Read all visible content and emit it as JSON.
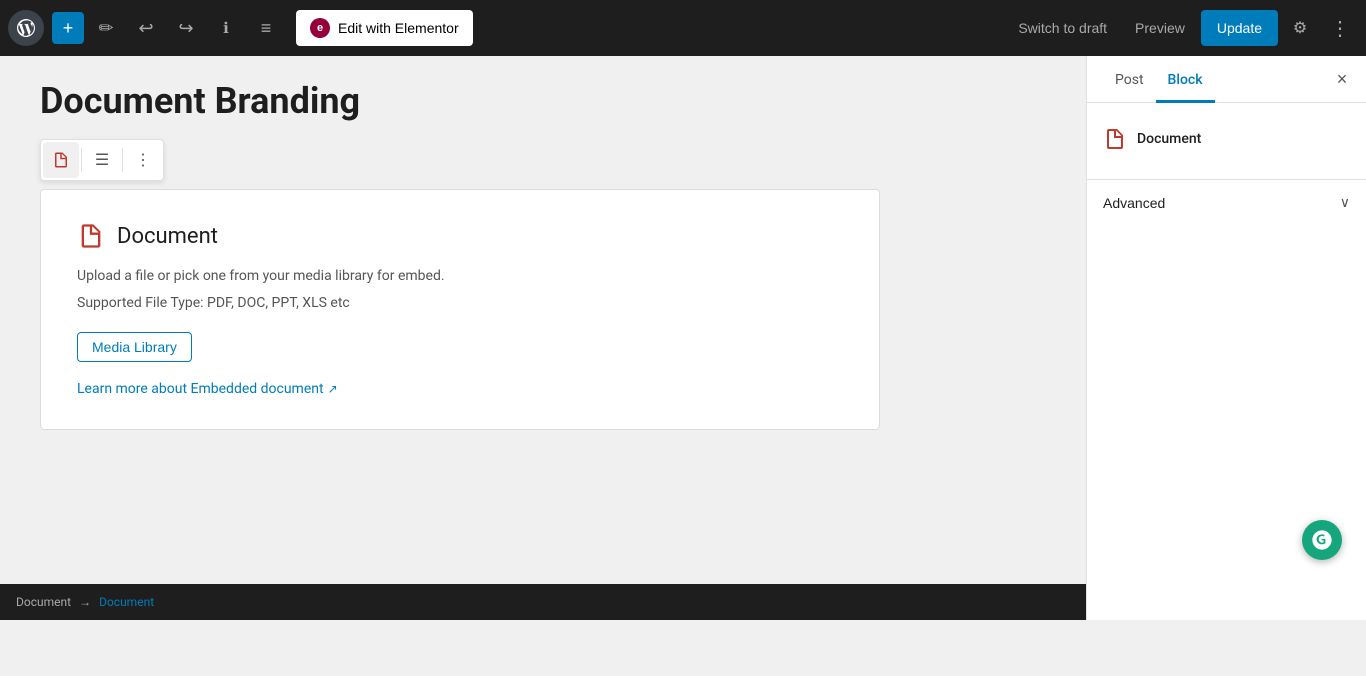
{
  "toolbar": {
    "add_label": "+",
    "edit_with_elementor": "Edit with Elementor",
    "elementor_icon": "e",
    "switch_to_draft": "Switch to draft",
    "preview": "Preview",
    "update": "Update"
  },
  "page": {
    "title": "Document Branding"
  },
  "block_toolbar": {
    "icon_btn_title": "Document icon",
    "list_btn_title": "List view",
    "more_btn_title": "More options"
  },
  "document_block": {
    "title": "Document",
    "description_line1": "Upload a file or pick one from your media library for embed.",
    "description_line2": "Supported File Type: PDF, DOC, PPT, XLS etc",
    "media_library_btn": "Media Library",
    "learn_more_text": "Learn more about Embedded document",
    "learn_more_icon": "↗"
  },
  "sidebar": {
    "post_tab": "Post",
    "block_tab": "Block",
    "close_label": "×",
    "block_panel": {
      "icon_label": "Document",
      "block_name": "Document"
    },
    "advanced_label": "Advanced",
    "chevron": "∨"
  },
  "breadcrumb": {
    "items": [
      {
        "label": "Document",
        "active": false
      },
      {
        "separator": "→"
      },
      {
        "label": "Document",
        "active": true
      }
    ]
  },
  "colors": {
    "accent_blue": "#007cba",
    "red_icon": "#c0392b",
    "toolbar_bg": "#1e1e1e",
    "white": "#ffffff"
  }
}
